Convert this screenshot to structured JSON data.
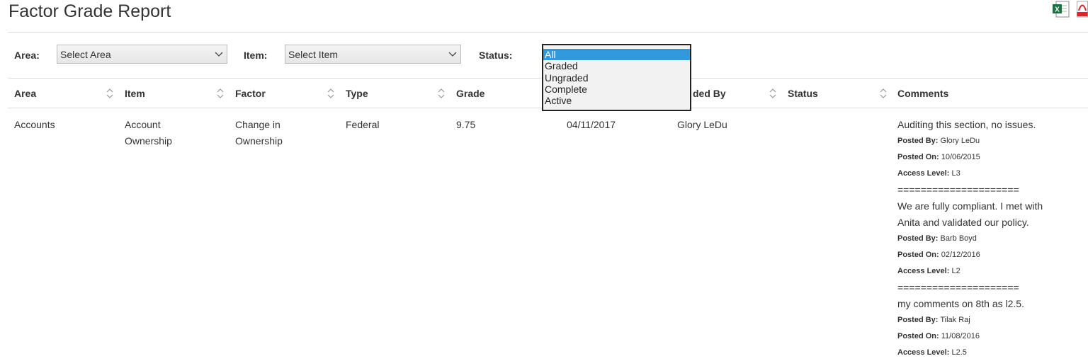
{
  "page": {
    "title": "Factor Grade Report"
  },
  "filters": {
    "area_label": "Area:",
    "area_value": "Select Area",
    "item_label": "Item:",
    "item_value": "Select Item",
    "status_label": "Status:",
    "status_options": [
      "All",
      "Graded",
      "Ungraded",
      "Complete",
      "Active"
    ],
    "status_selected": "All"
  },
  "table": {
    "columns": [
      "Area",
      "Item",
      "Factor",
      "Type",
      "Grade",
      "Graded By",
      "Status",
      "Comments"
    ],
    "graded_by_visible_label": "ded By",
    "row": {
      "area": "Accounts",
      "item_line1": "Account",
      "item_line2": "Ownership",
      "factor_line1": "Change in",
      "factor_line2": "Ownership",
      "type": "Federal",
      "grade": "9.75",
      "date": "04/11/2017",
      "graded_by": "Glory LeDu"
    },
    "comments": {
      "posted_by_label": "Posted By:",
      "posted_on_label": "Posted On:",
      "access_level_label": "Access Level:",
      "separator": "=====================",
      "c1_text": "Auditing this section, no issues.",
      "c1_by": "Glory LeDu",
      "c1_on": "10/06/2015",
      "c1_level": "L3",
      "c2_text_line1": "We are fully compliant. I met with",
      "c2_text_line2": "Anita and validated our policy.",
      "c2_by": "Barb Boyd",
      "c2_on": "02/12/2016",
      "c2_level": "L2",
      "c3_text": "my comments on 8th as l2.5.",
      "c3_by": "Tilak Raj",
      "c3_on": "11/08/2016",
      "c3_level": "L2.5"
    }
  },
  "colors": {
    "selected_option": "#3399dd",
    "excel_green": "#1e7145",
    "pdf_red": "#d9262e"
  },
  "icons": [
    "excel-export-icon",
    "pdf-export-icon",
    "chevron-down-icon",
    "sort-icon"
  ]
}
